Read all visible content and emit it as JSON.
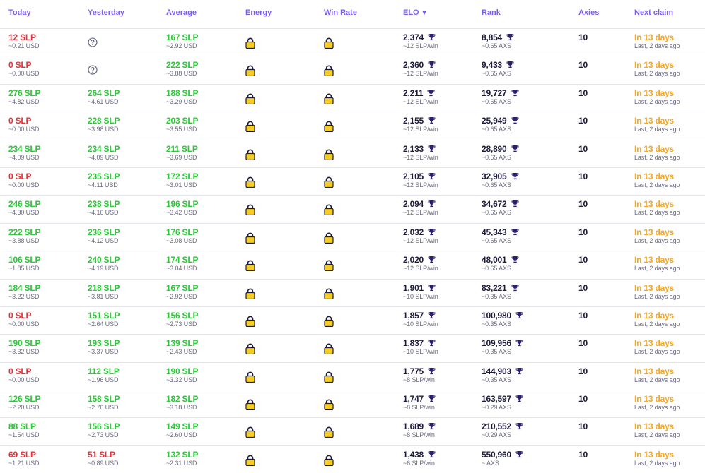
{
  "headers": {
    "today": "Today",
    "yesterday": "Yesterday",
    "average": "Average",
    "energy": "Energy",
    "win_rate": "Win Rate",
    "elo": "ELO",
    "rank": "Rank",
    "axies": "Axies",
    "next_claim": "Next claim"
  },
  "colors": {
    "accent": "#7b5cf0",
    "negative": "#e8313a",
    "positive": "#2cc838",
    "claim": "#f5a623",
    "lock_body": "#f5cd23"
  },
  "icons": {
    "sort": "sort-desc-icon",
    "energy": "lock-icon",
    "win_rate": "lock-icon",
    "elo": "trophy-icon",
    "rank": "trophy-icon",
    "missing": "help-circle-icon"
  },
  "rows": [
    {
      "today": "12 SLP",
      "today_usd": "~0.21 USD",
      "today_color": "red",
      "yest": null,
      "yest_usd": null,
      "yest_color": "",
      "avg": "167 SLP",
      "avg_usd": "~2.92 USD",
      "elo": "2,374",
      "elo_sub": "~12 SLP/win",
      "rank": "8,854",
      "rank_sub": "~0.65 AXS",
      "axies": "10",
      "claim": "In 13 days",
      "claim_sub": "Last, 2 days ago"
    },
    {
      "today": "0 SLP",
      "today_usd": "~0.00 USD",
      "today_color": "red",
      "yest": null,
      "yest_usd": null,
      "yest_color": "",
      "avg": "222 SLP",
      "avg_usd": "~3.88 USD",
      "elo": "2,360",
      "elo_sub": "~12 SLP/win",
      "rank": "9,433",
      "rank_sub": "~0.65 AXS",
      "axies": "10",
      "claim": "In 13 days",
      "claim_sub": "Last, 2 days ago"
    },
    {
      "today": "276 SLP",
      "today_usd": "~4.82 USD",
      "today_color": "green",
      "yest": "264 SLP",
      "yest_usd": "~4.61 USD",
      "yest_color": "green",
      "avg": "188 SLP",
      "avg_usd": "~3.29 USD",
      "elo": "2,211",
      "elo_sub": "~12 SLP/win",
      "rank": "19,727",
      "rank_sub": "~0.65 AXS",
      "axies": "10",
      "claim": "In 13 days",
      "claim_sub": "Last, 2 days ago"
    },
    {
      "today": "0 SLP",
      "today_usd": "~0.00 USD",
      "today_color": "red",
      "yest": "228 SLP",
      "yest_usd": "~3.98 USD",
      "yest_color": "green",
      "avg": "203 SLP",
      "avg_usd": "~3.55 USD",
      "elo": "2,155",
      "elo_sub": "~12 SLP/win",
      "rank": "25,949",
      "rank_sub": "~0.65 AXS",
      "axies": "10",
      "claim": "In 13 days",
      "claim_sub": "Last, 2 days ago"
    },
    {
      "today": "234 SLP",
      "today_usd": "~4.09 USD",
      "today_color": "green",
      "yest": "234 SLP",
      "yest_usd": "~4.09 USD",
      "yest_color": "green",
      "avg": "211 SLP",
      "avg_usd": "~3.69 USD",
      "elo": "2,133",
      "elo_sub": "~12 SLP/win",
      "rank": "28,890",
      "rank_sub": "~0.65 AXS",
      "axies": "10",
      "claim": "In 13 days",
      "claim_sub": "Last, 2 days ago"
    },
    {
      "today": "0 SLP",
      "today_usd": "~0.00 USD",
      "today_color": "red",
      "yest": "235 SLP",
      "yest_usd": "~4.11 USD",
      "yest_color": "green",
      "avg": "172 SLP",
      "avg_usd": "~3.01 USD",
      "elo": "2,105",
      "elo_sub": "~12 SLP/win",
      "rank": "32,905",
      "rank_sub": "~0.65 AXS",
      "axies": "10",
      "claim": "In 13 days",
      "claim_sub": "Last, 2 days ago"
    },
    {
      "today": "246 SLP",
      "today_usd": "~4.30 USD",
      "today_color": "green",
      "yest": "238 SLP",
      "yest_usd": "~4.16 USD",
      "yest_color": "green",
      "avg": "196 SLP",
      "avg_usd": "~3.42 USD",
      "elo": "2,094",
      "elo_sub": "~12 SLP/win",
      "rank": "34,672",
      "rank_sub": "~0.65 AXS",
      "axies": "10",
      "claim": "In 13 days",
      "claim_sub": "Last, 2 days ago"
    },
    {
      "today": "222 SLP",
      "today_usd": "~3.88 USD",
      "today_color": "green",
      "yest": "236 SLP",
      "yest_usd": "~4.12 USD",
      "yest_color": "green",
      "avg": "176 SLP",
      "avg_usd": "~3.08 USD",
      "elo": "2,032",
      "elo_sub": "~12 SLP/win",
      "rank": "45,343",
      "rank_sub": "~0.65 AXS",
      "axies": "10",
      "claim": "In 13 days",
      "claim_sub": "Last, 2 days ago"
    },
    {
      "today": "106 SLP",
      "today_usd": "~1.85 USD",
      "today_color": "green",
      "yest": "240 SLP",
      "yest_usd": "~4.19 USD",
      "yest_color": "green",
      "avg": "174 SLP",
      "avg_usd": "~3.04 USD",
      "elo": "2,020",
      "elo_sub": "~12 SLP/win",
      "rank": "48,001",
      "rank_sub": "~0.65 AXS",
      "axies": "10",
      "claim": "In 13 days",
      "claim_sub": "Last, 2 days ago"
    },
    {
      "today": "184 SLP",
      "today_usd": "~3.22 USD",
      "today_color": "green",
      "yest": "218 SLP",
      "yest_usd": "~3.81 USD",
      "yest_color": "green",
      "avg": "167 SLP",
      "avg_usd": "~2.92 USD",
      "elo": "1,901",
      "elo_sub": "~10 SLP/win",
      "rank": "83,221",
      "rank_sub": "~0.35 AXS",
      "axies": "10",
      "claim": "In 13 days",
      "claim_sub": "Last, 2 days ago"
    },
    {
      "today": "0 SLP",
      "today_usd": "~0.00 USD",
      "today_color": "red",
      "yest": "151 SLP",
      "yest_usd": "~2.64 USD",
      "yest_color": "green",
      "avg": "156 SLP",
      "avg_usd": "~2.73 USD",
      "elo": "1,857",
      "elo_sub": "~10 SLP/win",
      "rank": "100,980",
      "rank_sub": "~0.35 AXS",
      "axies": "10",
      "claim": "In 13 days",
      "claim_sub": "Last, 2 days ago"
    },
    {
      "today": "190 SLP",
      "today_usd": "~3.32 USD",
      "today_color": "green",
      "yest": "193 SLP",
      "yest_usd": "~3.37 USD",
      "yest_color": "green",
      "avg": "139 SLP",
      "avg_usd": "~2.43 USD",
      "elo": "1,837",
      "elo_sub": "~10 SLP/win",
      "rank": "109,956",
      "rank_sub": "~0.35 AXS",
      "axies": "10",
      "claim": "In 13 days",
      "claim_sub": "Last, 2 days ago"
    },
    {
      "today": "0 SLP",
      "today_usd": "~0.00 USD",
      "today_color": "red",
      "yest": "112 SLP",
      "yest_usd": "~1.96 USD",
      "yest_color": "green",
      "avg": "190 SLP",
      "avg_usd": "~3.32 USD",
      "elo": "1,775",
      "elo_sub": "~8 SLP/win",
      "rank": "144,903",
      "rank_sub": "~0.35 AXS",
      "axies": "10",
      "claim": "In 13 days",
      "claim_sub": "Last, 2 days ago"
    },
    {
      "today": "126 SLP",
      "today_usd": "~2.20 USD",
      "today_color": "green",
      "yest": "158 SLP",
      "yest_usd": "~2.76 USD",
      "yest_color": "green",
      "avg": "182 SLP",
      "avg_usd": "~3.18 USD",
      "elo": "1,747",
      "elo_sub": "~8 SLP/win",
      "rank": "163,597",
      "rank_sub": "~0.29 AXS",
      "axies": "10",
      "claim": "In 13 days",
      "claim_sub": "Last, 2 days ago"
    },
    {
      "today": "88 SLP",
      "today_usd": "~1.54 USD",
      "today_color": "green",
      "yest": "156 SLP",
      "yest_usd": "~2.73 USD",
      "yest_color": "green",
      "avg": "149 SLP",
      "avg_usd": "~2.60 USD",
      "elo": "1,689",
      "elo_sub": "~8 SLP/win",
      "rank": "210,552",
      "rank_sub": "~0.29 AXS",
      "axies": "10",
      "claim": "In 13 days",
      "claim_sub": "Last, 2 days ago"
    },
    {
      "today": "69 SLP",
      "today_usd": "~1.21 USD",
      "today_color": "red",
      "yest": "51 SLP",
      "yest_usd": "~0.89 USD",
      "yest_color": "red",
      "avg": "132 SLP",
      "avg_usd": "~2.31 USD",
      "elo": "1,438",
      "elo_sub": "~6 SLP/win",
      "rank": "550,960",
      "rank_sub": "~ AXS",
      "axies": "10",
      "claim": "In 13 days",
      "claim_sub": "Last, 2 days ago"
    }
  ]
}
